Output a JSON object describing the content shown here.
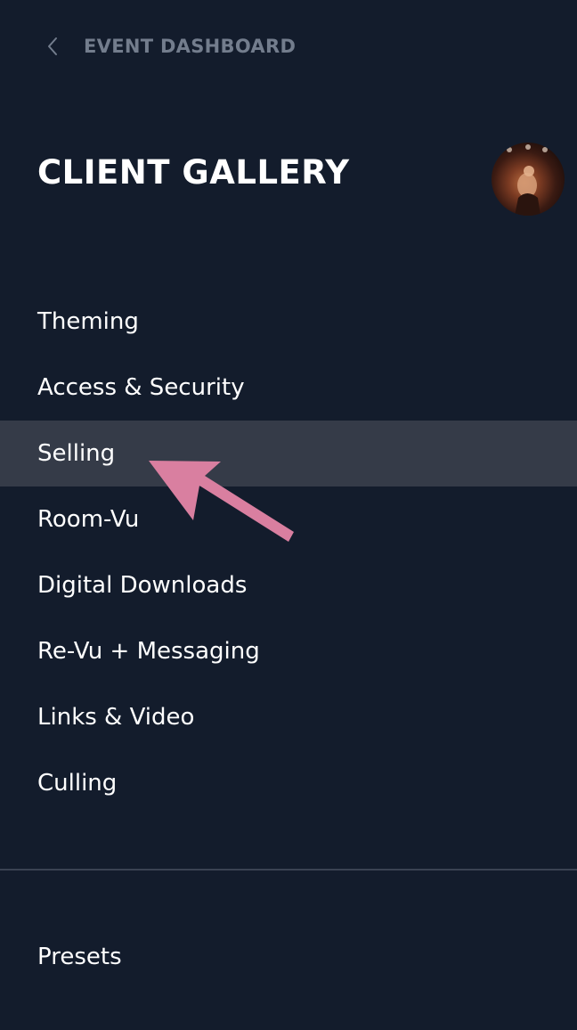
{
  "header": {
    "back_label": "EVENT DASHBOARD",
    "back_icon": "chevron-left-icon"
  },
  "page": {
    "title": "CLIENT GALLERY"
  },
  "menu": {
    "items": [
      {
        "label": "Theming"
      },
      {
        "label": "Access & Security"
      },
      {
        "label": "Selling"
      },
      {
        "label": "Room-Vu"
      },
      {
        "label": "Digital Downloads"
      },
      {
        "label": "Re-Vu + Messaging"
      },
      {
        "label": "Links & Video"
      },
      {
        "label": "Culling"
      }
    ],
    "active_item": "Selling"
  },
  "footer": {
    "presets_label": "Presets"
  },
  "annotation": {
    "icon": "pointer-arrow-icon",
    "color": "#d97fa0"
  },
  "colors": {
    "background": "#131c2c",
    "active_row": "#353b48",
    "muted_text": "#737d8d"
  }
}
